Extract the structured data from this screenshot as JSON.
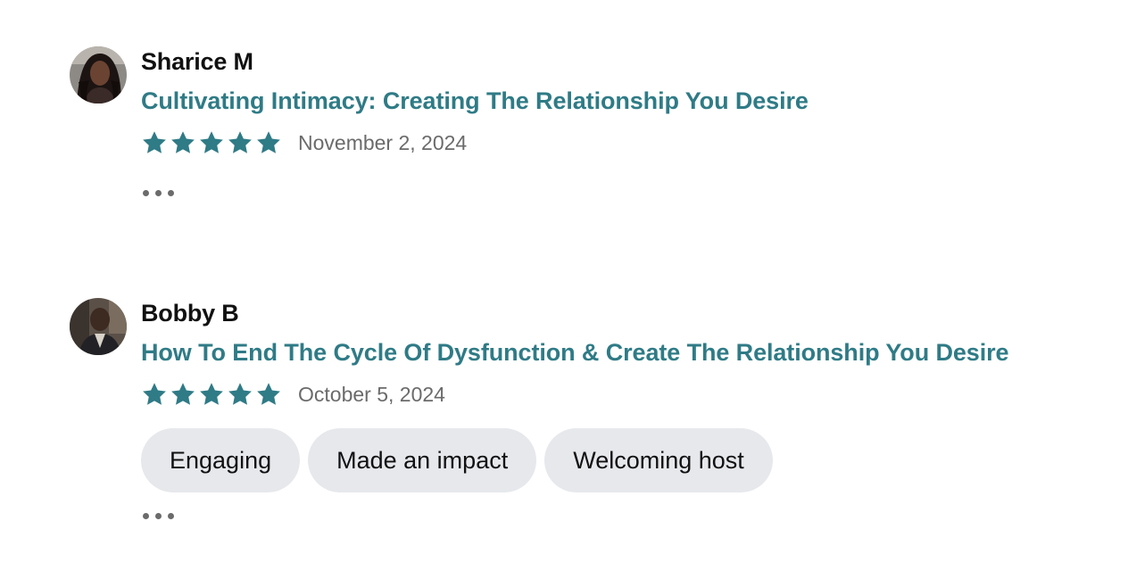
{
  "accent_color": "#2f7b86",
  "reviews": [
    {
      "reviewer_name": "Sharice M",
      "event_title": "Cultivating Intimacy: Creating The Relationship You Desire",
      "rating": 5,
      "date": "November 2, 2024",
      "tags": []
    },
    {
      "reviewer_name": "Bobby B",
      "event_title": "How To End The Cycle Of Dysfunction & Create The Relationship You Desire",
      "rating": 5,
      "date": "October 5, 2024",
      "tags": [
        "Engaging",
        "Made an impact",
        "Welcoming host"
      ]
    }
  ],
  "icons": {
    "star": "star-icon",
    "more": "more-options-icon"
  }
}
